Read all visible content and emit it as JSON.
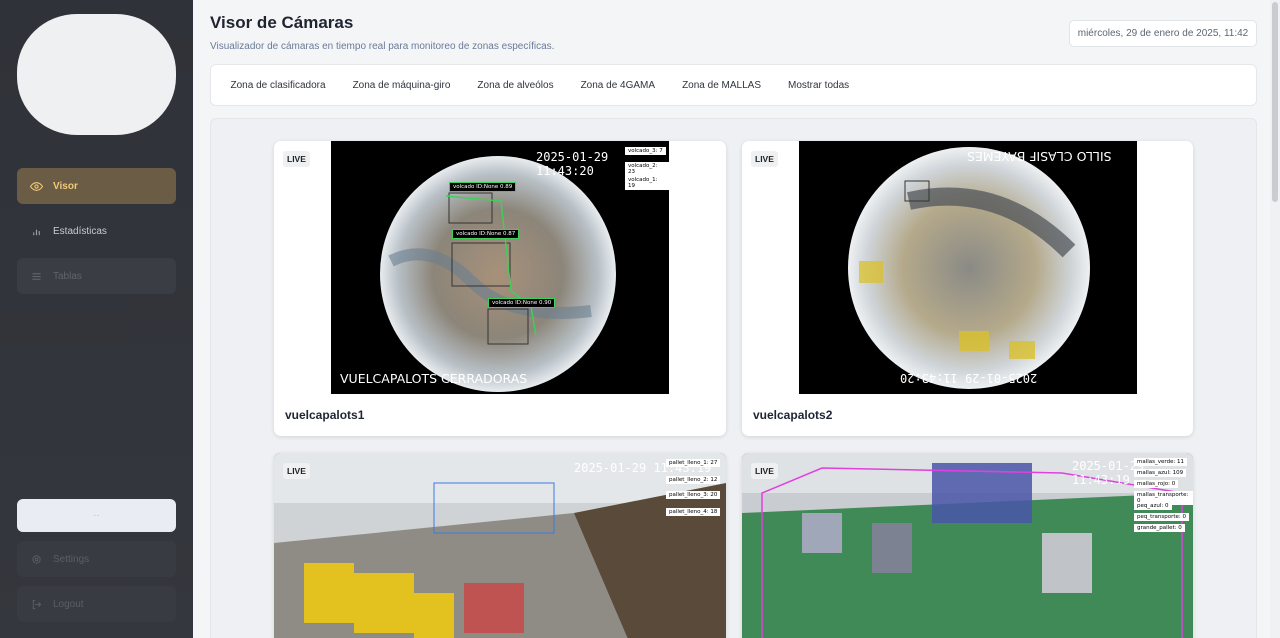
{
  "sidebar": {
    "items": [
      {
        "label": "Visor",
        "icon": "eye-icon"
      },
      {
        "label": "Estadísticas",
        "icon": "bar-chart-icon"
      },
      {
        "label": "Tablas",
        "icon": "table-icon"
      }
    ],
    "settings_label": "Settings",
    "logout_label": "Logout",
    "accent": "#f1c97a"
  },
  "header": {
    "title": "Visor de Cámaras",
    "subtitle": "Visualizador de cámaras en tiempo real para monitoreo de zonas específicas.",
    "datetime": "miércoles, 29 de enero de 2025, 11:42"
  },
  "zones": [
    "Zona de clasificadora",
    "Zona de máquina-giro",
    "Zona de alveólos",
    "Zona de 4GAMA",
    "Zona de MALLAS",
    "Mostrar todas"
  ],
  "cameras": [
    {
      "name": "vuelcapalots1",
      "badge": "LIVE",
      "timestamp": "2025-01-29 11:43:20",
      "overlay_label": "VUELCAPALOTS CERRADORAS",
      "counters": [
        "volcado_3: 7",
        "volcado_2: 23",
        "volcado_1: 19"
      ],
      "detections": [
        "volcado ID:None 0.89",
        "volcado ID:None 0.87",
        "volcado ID:None 0.90"
      ]
    },
    {
      "name": "vuelcapalots2",
      "badge": "LIVE",
      "timestamp": "2025-01-29 11:43:20",
      "overlay_label": "SILLO CLASIF BAYEMES"
    },
    {
      "name": "",
      "badge": "LIVE",
      "timestamp": "2025-01-29 11:43:19",
      "counters": [
        "pallet_lleno_1: 27",
        "pallet_lleno_2: 12",
        "pallet_lleno_3: 20",
        "pallet_lleno_4: 18"
      ]
    },
    {
      "name": "",
      "badge": "LIVE",
      "timestamp": "2025-01-29 11:43:19",
      "counters": [
        "mallas_verde: 11",
        "mallas_azul: 109",
        "mallas_rojo: 0",
        "mallas_transporte: 0",
        "peq_azul: 0",
        "peq_transporte: 0",
        "grande_pallet: 0"
      ]
    }
  ]
}
